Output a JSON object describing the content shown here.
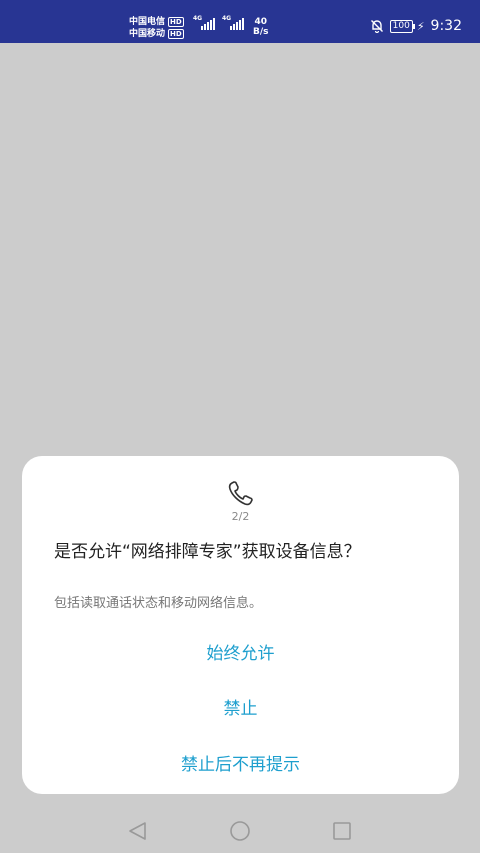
{
  "status_bar": {
    "carrier_1": "中国电信",
    "carrier_2": "中国移动",
    "hd": "HD",
    "network_type": "4G",
    "speed_value": "40",
    "speed_unit": "B/s",
    "battery": "100",
    "time": "9:32",
    "icons": [
      "mute-bell-icon",
      "battery-icon",
      "charging-bolt-icon"
    ],
    "color": "#283593"
  },
  "dialog": {
    "icon": "phone-icon",
    "counter": "2/2",
    "question": "是否允许“网络排障专家”获取设备信息？",
    "description": "包括读取通话状态和移动网络信息。",
    "actions": {
      "allow_always": "始终允许",
      "deny": "禁止",
      "deny_dont_ask": "禁止后不再提示"
    },
    "accent_color": "#1e9fce"
  },
  "nav_bar": {
    "icons": [
      "back-triangle-icon",
      "home-circle-icon",
      "recent-square-icon"
    ]
  }
}
